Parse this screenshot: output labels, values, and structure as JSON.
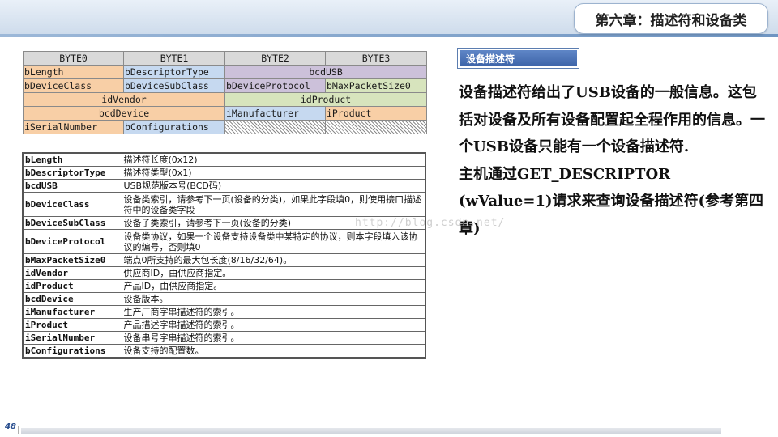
{
  "header": {
    "chapter_title": "第六章：描述符和设备类"
  },
  "layout_table": {
    "byte_headers": [
      "BYTE0",
      "BYTE1",
      "BYTE2",
      "BYTE3"
    ],
    "rows": [
      [
        "bLength",
        "bDescriptorType",
        "bcdUSB"
      ],
      [
        "bDeviceClass",
        "bDeviceSubClass",
        "bDeviceProtocol",
        "bMaxPacketSize0"
      ],
      [
        "idVendor",
        "idProduct"
      ],
      [
        "bcdDevice",
        "iManufacturer",
        "iProduct"
      ],
      [
        "iSerialNumber",
        "bConfigurations"
      ]
    ],
    "colors": {
      "orange": "#f8cfa6",
      "blue": "#c6d9f0",
      "purple": "#ccc1da",
      "green": "#d7e4bd",
      "header": "#d9d9d9"
    }
  },
  "field_table": [
    {
      "name": "bLength",
      "desc": "描述符长度(0x12)"
    },
    {
      "name": "bDescriptorType",
      "desc": "描述符类型(0x1)"
    },
    {
      "name": "bcdUSB",
      "desc": "USB规范版本号(BCD码)"
    },
    {
      "name": "bDeviceClass",
      "desc": "设备类索引，请参考下一页(设备的分类)，如果此字段填0，则使用接口描述符中的设备类字段"
    },
    {
      "name": "bDeviceSubClass",
      "desc": "设备子类索引，请参考下一页(设备的分类)"
    },
    {
      "name": "bDeviceProtocol",
      "desc": "设备类协议，如果一个设备支持设备类中某特定的协议，则本字段填入该协议的编号，否则填0"
    },
    {
      "name": "bMaxPacketSize0",
      "desc": "端点0所支持的最大包长度(8/16/32/64)。"
    },
    {
      "name": "idVendor",
      "desc": "供应商ID，由供应商指定。"
    },
    {
      "name": "idProduct",
      "desc": "产品ID，由供应商指定。"
    },
    {
      "name": "bcdDevice",
      "desc": "设备版本。"
    },
    {
      "name": "iManufacturer",
      "desc": "生产厂商字串描述符的索引。"
    },
    {
      "name": "iProduct",
      "desc": "产品描述字串描述符的索引。"
    },
    {
      "name": "iSerialNumber",
      "desc": "设备串号字串描述符的索引。"
    },
    {
      "name": "bConfigurations",
      "desc": "设备支持的配置数。"
    }
  ],
  "side": {
    "label": "设备描述符",
    "paragraphs": [
      "设备描述符给出了USB设备的一般信息。这包括对设备及所有设备配置起全程作用的信息。一个USB设备只能有一个设备描述符.",
      "主机通过GET_DESCRIPTOR (wValue=1)请求来查询设备描述符(参考第四章)"
    ]
  },
  "watermark": "http://blog.csdn.net/",
  "footer": {
    "page_number": "48"
  }
}
